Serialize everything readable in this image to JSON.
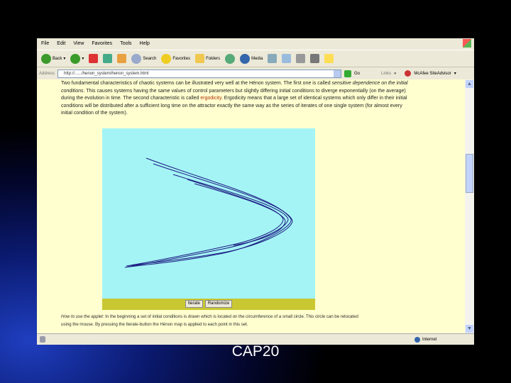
{
  "slide": {
    "caption": "CAP20"
  },
  "browser": {
    "menu": [
      "File",
      "Edit",
      "View",
      "Favorites",
      "Tools",
      "Help"
    ],
    "toolbar": {
      "back": "Back",
      "search": "Search",
      "favorites": "Favorites",
      "folders": "Folders",
      "media": "Media"
    },
    "address": {
      "label": "Address",
      "url": "http://....../henon_system/henon_system.html",
      "go": "Go",
      "links": "Links",
      "links_item": "McAfee SiteAdvisor"
    },
    "status": {
      "zone": "Internet"
    }
  },
  "page": {
    "para1_a": "Two fundamental characteristics of chaotic systems can be illustrated very well at the Hénon system. The first one is called ",
    "para1_em": "sensitive dependence on the initial conditions",
    "para1_b": ". This causes systems having the same values of control parameters but slightly differing initial conditions to diverge exponentially (on the average) during the evolution in time. The second characteristic is called ",
    "para1_link": "ergodicity",
    "para1_c": ". Ergodicity means that a large set of identical systems which only differ in their initial conditions will be distributed after a sufficient long time on the attractor exactly the same way as the series of iterates of one single system (for almost every initial condition of the system).",
    "para2_em": "How to use the applet:",
    "para2": " In the beginning a set of initial conditions is drawn which is located on the circumference of a small circle. This circle can be relocated using the mouse. By pressing the Iterate-button the Hénon map is applied to each point in this set.",
    "applet": {
      "iterate": "Iterate",
      "randomize": "Randomize",
      "curve_color": "#1a1a80",
      "bg_color": "#a4f4f6",
      "bar_color": "#c9c832"
    }
  }
}
